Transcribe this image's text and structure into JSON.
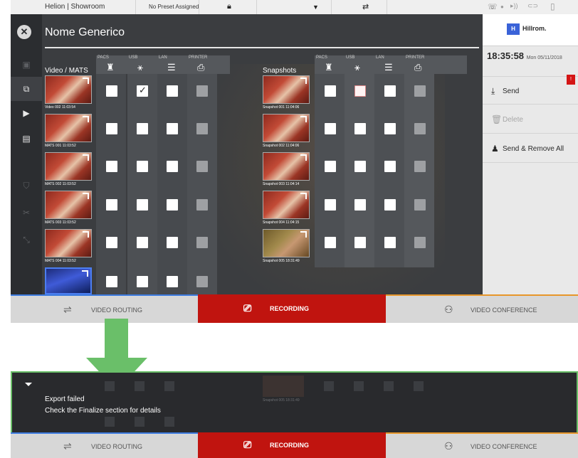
{
  "statusbar": {
    "location": "Helion | Showroom",
    "preset": "No Preset Assigned",
    "icons": [
      "lock-icon",
      "dropdown-icon",
      "sync-users-icon",
      "phone-icon",
      "record-dot-icon",
      "wireless-icon",
      "link-icon",
      "battery-icon"
    ]
  },
  "screen": {
    "title": "Nome Generico",
    "left_nav": [
      "close-icon",
      "clipboard-icon",
      "video-export-icon",
      "video-icon",
      "film-icon",
      "shield-icon",
      "tools-icon",
      "resize-icon"
    ]
  },
  "video_section": {
    "title": "Video / MATS",
    "columns": [
      "PACS",
      "USB",
      "LAN",
      "PRINTER"
    ],
    "rows": [
      {
        "caption": "Video 002 11:03:54",
        "checks": [
          "empty",
          "checked",
          "empty",
          "grey"
        ]
      },
      {
        "caption": "MATS 001 11:03:52",
        "checks": [
          "empty",
          "empty",
          "empty",
          "grey"
        ]
      },
      {
        "caption": "MATS 002 11:03:52",
        "checks": [
          "empty",
          "empty",
          "empty",
          "grey"
        ]
      },
      {
        "caption": "MATS 003 11:03:52",
        "checks": [
          "empty",
          "empty",
          "empty",
          "grey"
        ]
      },
      {
        "caption": "MATS 004 11:03:52",
        "checks": [
          "empty",
          "empty",
          "empty",
          "grey"
        ]
      },
      {
        "caption": "",
        "checks": [
          "empty",
          "empty",
          "empty",
          "grey"
        ]
      }
    ]
  },
  "snapshot_section": {
    "title": "Snapshots",
    "columns": [
      "PACS",
      "USB",
      "LAN",
      "PRINTER"
    ],
    "rows": [
      {
        "caption": "Snapshot 001 11:04:06",
        "checks": [
          "empty",
          "error",
          "empty",
          "grey"
        ]
      },
      {
        "caption": "Snapshot 002 11:04:06",
        "checks": [
          "empty",
          "empty",
          "empty",
          "grey"
        ]
      },
      {
        "caption": "Snapshot 003 11:04:14",
        "checks": [
          "empty",
          "empty",
          "empty",
          "grey"
        ]
      },
      {
        "caption": "Snapshot 004 11:04:15",
        "checks": [
          "empty",
          "empty",
          "empty",
          "grey"
        ]
      },
      {
        "caption": "Snapshot 005 18:31:49",
        "checks": [
          "empty",
          "empty",
          "empty",
          "grey"
        ]
      }
    ]
  },
  "right_panel": {
    "brand": "Hillrom.",
    "brand_mark": "H",
    "time": "18:35:58",
    "date": "Mon 05/11/2018",
    "badge": "!",
    "actions": [
      {
        "label": "Send",
        "icon": "download-icon",
        "enabled": true
      },
      {
        "label": "Delete",
        "icon": "trash-icon",
        "enabled": false
      },
      {
        "label": "Send & Remove All",
        "icon": "user-remove-icon",
        "enabled": true
      }
    ]
  },
  "tabs": {
    "routing": "VIDEO ROUTING",
    "recording": "RECORDING",
    "conference": "VIDEO CONFERENCE"
  },
  "notification": {
    "title": "Export failed",
    "message": "Check the Finalize section for details",
    "ghost_caption": "Snapshot 005 18:31:49"
  },
  "colors": {
    "accent_green": "#6abf69",
    "recording_red": "#c0140f",
    "routing_blue": "#3d7be0",
    "conference_orange": "#e7962a",
    "badge_red": "#d41515"
  }
}
